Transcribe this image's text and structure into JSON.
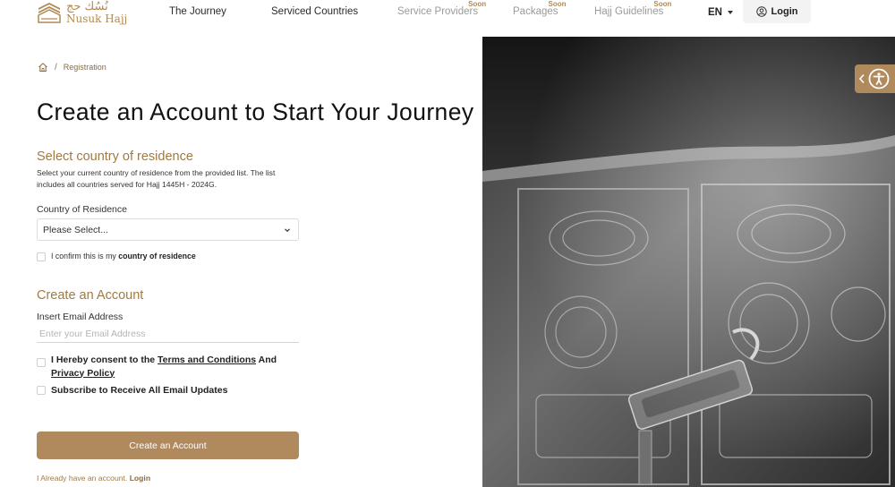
{
  "header": {
    "logo_ar": "نُسُك حج",
    "logo_en": "Nusuk Hajj",
    "nav": [
      {
        "label": "The Journey",
        "soon": ""
      },
      {
        "label": "Serviced Countries",
        "soon": ""
      },
      {
        "label": "Service Providers",
        "soon": "Soon"
      },
      {
        "label": "Packages",
        "soon": "Soon"
      },
      {
        "label": "Hajj Guidelines",
        "soon": "Soon"
      }
    ],
    "language": "EN",
    "login_label": "Login"
  },
  "breadcrumb": {
    "current": "Registration",
    "separator": "/"
  },
  "page_title": "Create an Account to Start Your Journey",
  "residence": {
    "title": "Select country of residence",
    "description": "Select your current country of residence from the provided list. The list includes all countries served for Hajj 1445H - 2024G.",
    "field_label": "Country of Residence",
    "selected_value": "Please Select...",
    "confirm_prefix": "I confirm this is my",
    "confirm_bold": "country of residence"
  },
  "account": {
    "title": "Create an Account",
    "email_label": "Insert Email Address",
    "email_placeholder": "Enter your Email Address",
    "email_value": "",
    "consent_prefix": "I Hereby consent to the",
    "terms_link": "Terms and Conditions",
    "consent_and": "And",
    "privacy_link": "Privacy Policy",
    "subscribe_label": "Subscribe to Receive All Email Updates",
    "submit_label": "Create an Account",
    "already_text": "I Already have an account.",
    "already_login": "Login"
  },
  "colors": {
    "accent": "#b08a5c",
    "accent_text": "#a07a45"
  }
}
